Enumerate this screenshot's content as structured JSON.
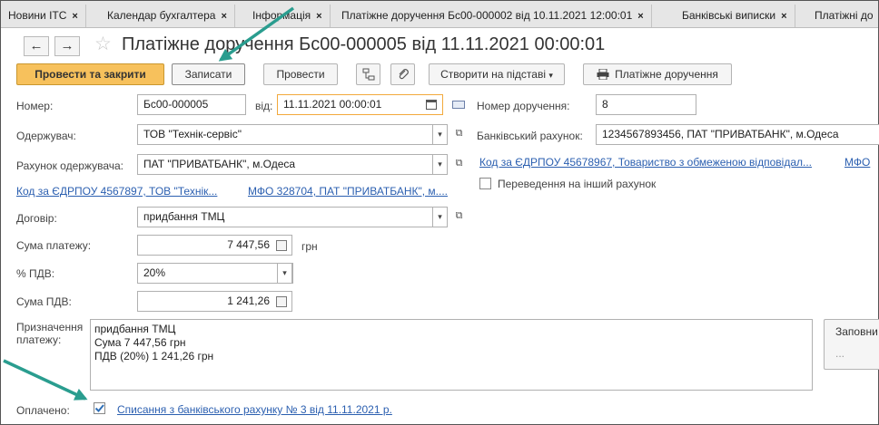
{
  "tabs": [
    {
      "label": "Новини ІТС",
      "closable": true
    },
    {
      "label": "Календар бухгалтера",
      "closable": true
    },
    {
      "label": "Інформація",
      "closable": true
    },
    {
      "label": "Платіжне доручення Бс00-000002 від 10.11.2021 12:00:01",
      "closable": true
    },
    {
      "label": "Банківські виписки",
      "closable": true
    },
    {
      "label": "Платіжні до",
      "closable": false
    }
  ],
  "tab_close_glyph": "×",
  "nav": {
    "back": "←",
    "forward": "→"
  },
  "document": {
    "title": "Платіжне доручення Бс00-000005 від 11.11.2021 00:00:01"
  },
  "toolbar": {
    "post_and_close": "Провести та закрити",
    "save": "Записати",
    "post": "Провести",
    "create_based_on": "Створити на підставі",
    "print_payment_order": "Платіжне доручення"
  },
  "form": {
    "number_label": "Номер:",
    "number_value": "Бс00-000005",
    "date_label": "від:",
    "date_value": "11.11.2021 00:00:01",
    "order_number_label": "Номер доручення:",
    "order_number_value": "8",
    "recipient_label": "Одержувач:",
    "recipient_value": "ТОВ \"Технік-сервіс\"",
    "bank_account_label": "Банківський рахунок:",
    "bank_account_value": "1234567893456, ПАТ \"ПРИВАТБАНК\", м.Одеса",
    "recipient_account_label": "Рахунок одержувача:",
    "recipient_account_value": "ПАТ \"ПРИВАТБАНК\", м.Одеса",
    "org_edrpou_link": "Код за ЄДРПОУ 45678967, Товариство з обмеженою відповідал...",
    "org_mfo_link": "МФО",
    "recipient_edrpou_link": "Код за ЄДРПОУ 4567897, ТОВ \"Технік...",
    "recipient_mfo_link": "МФО 328704, ПАТ \"ПРИВАТБАНК\", м....",
    "transfer_other_account_label": "Переведення на інший рахунок",
    "transfer_other_account_checked": false,
    "contract_label": "Договір:",
    "contract_value": "придбання ТМЦ",
    "amount_label": "Сума платежу:",
    "amount_value": "7 447,56",
    "currency": "грн",
    "vat_rate_label": "% ПДВ:",
    "vat_rate_value": "20%",
    "vat_amount_label": "Сума ПДВ:",
    "vat_amount_value": "1 241,26",
    "purpose_label_1": "Призначення",
    "purpose_label_2": "платежу:",
    "purpose_lines": [
      "придбання ТМЦ",
      "Сума 7 447,56 грн",
      "ПДВ (20%) 1 241,26 грн"
    ],
    "fill_button": "Заповни",
    "fill_button_dots": "...",
    "paid_label": "Оплачено:",
    "paid_checked": true,
    "paid_link": "Списання з банківського рахунку № 3 від 11.11.2021 р."
  },
  "colors": {
    "accent_button": "#f7c15c",
    "link": "#2b5fb0",
    "annotation_arrow": "#2a9d8f"
  }
}
